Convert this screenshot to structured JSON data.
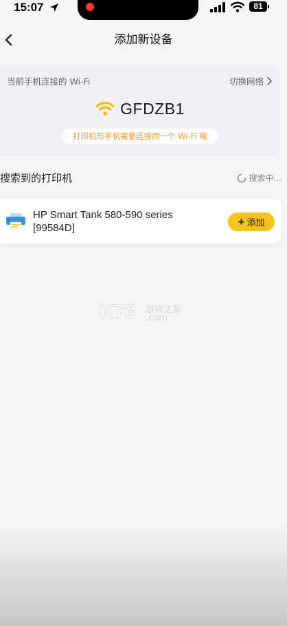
{
  "status_bar": {
    "time": "15:07",
    "battery": "81"
  },
  "nav": {
    "title": "添加新设备"
  },
  "wifi_card": {
    "label": "当前手机连接的 Wi-Fi",
    "switch_network": "切换网络",
    "network_name": "GFDZB1",
    "notice": "打印机与手机需要连接同一个 Wi-Fi 哦"
  },
  "search": {
    "section_title": "搜索到的打印机",
    "status": "搜索中..."
  },
  "printers": [
    {
      "name": "HP Smart Tank 580-590 series [99584D]",
      "add_label": "添加"
    }
  ],
  "watermark": {
    "logo": "K73",
    "cn": "游戏之家",
    "com": ".com"
  },
  "colors": {
    "accent": "#f7c21a",
    "notice_text": "#f0962d",
    "wifi_icon": "#f5b900"
  }
}
